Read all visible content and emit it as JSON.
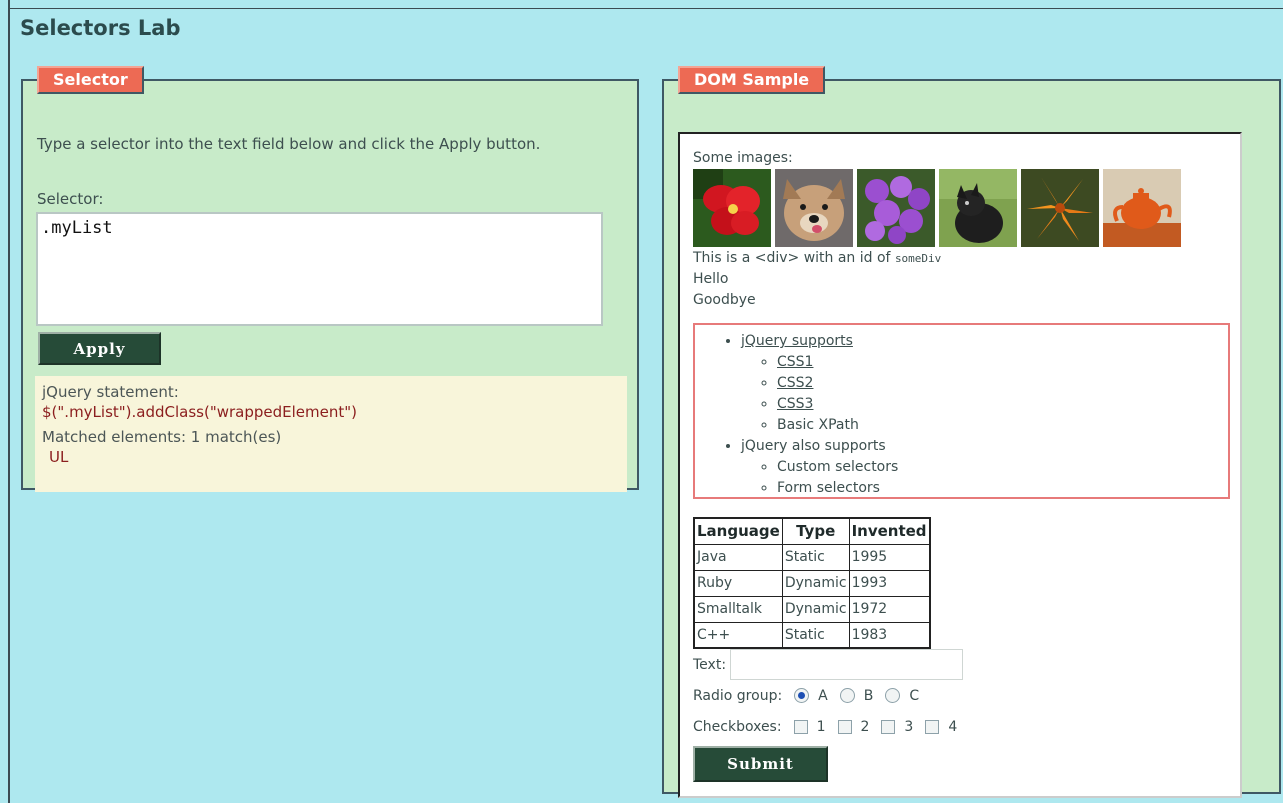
{
  "page_title": "Selectors Lab",
  "selector_panel": {
    "legend": "Selector",
    "instructions": "Type a selector into the text field below and click the Apply button.",
    "selector_label": "Selector:",
    "selector_value": ".myList",
    "apply_label": "Apply",
    "statement_label": "jQuery statement:",
    "statement": "$(\".myList\").addClass(\"wrappedElement\")",
    "matched_label": "Matched elements: 1 match(es)",
    "matched_items": [
      "UL"
    ]
  },
  "dom_panel": {
    "legend": "DOM Sample",
    "images_label": "Some images:",
    "images": [
      "hibiscus",
      "dog",
      "purple-flowers",
      "black-dog",
      "lily",
      "teapot"
    ],
    "div_text": "This is a <div> with an id of",
    "div_id": "someDiv",
    "hello": "Hello",
    "goodbye": "Goodbye",
    "list": [
      {
        "label": "jQuery supports",
        "link": true,
        "children": [
          {
            "label": "CSS1",
            "link": true
          },
          {
            "label": "CSS2",
            "link": true
          },
          {
            "label": "CSS3",
            "link": true
          },
          {
            "label": "Basic XPath",
            "link": false
          }
        ]
      },
      {
        "label": "jQuery also supports",
        "link": false,
        "children": [
          {
            "label": "Custom selectors",
            "link": false
          },
          {
            "label": "Form selectors",
            "link": false
          }
        ]
      }
    ],
    "table": {
      "headers": [
        "Language",
        "Type",
        "Invented"
      ],
      "rows": [
        [
          "Java",
          "Static",
          "1995"
        ],
        [
          "Ruby",
          "Dynamic",
          "1993"
        ],
        [
          "Smalltalk",
          "Dynamic",
          "1972"
        ],
        [
          "C++",
          "Static",
          "1983"
        ]
      ]
    },
    "text_label": "Text:",
    "text_value": "",
    "radio_label": "Radio group:",
    "radios": [
      {
        "label": "A",
        "checked": true
      },
      {
        "label": "B",
        "checked": false
      },
      {
        "label": "C",
        "checked": false
      }
    ],
    "checkbox_label": "Checkboxes:",
    "checkboxes": [
      {
        "label": "1",
        "checked": false
      },
      {
        "label": "2",
        "checked": false
      },
      {
        "label": "3",
        "checked": false
      },
      {
        "label": "4",
        "checked": false
      }
    ],
    "submit_label": "Submit"
  }
}
